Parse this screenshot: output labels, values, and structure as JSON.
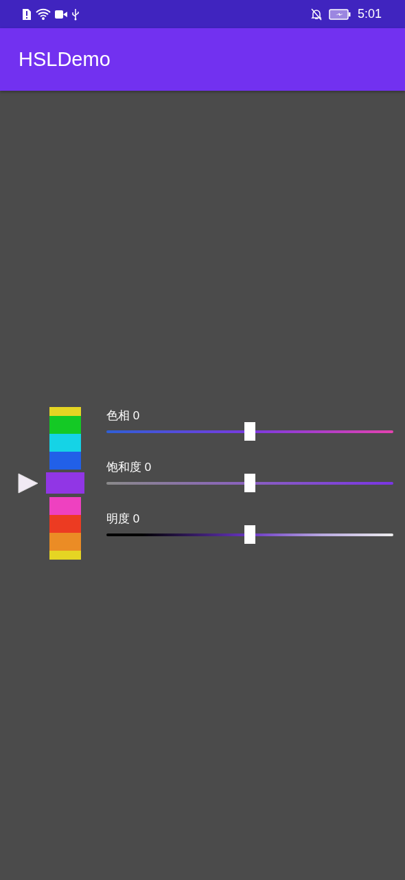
{
  "status_bar": {
    "time": "5:01"
  },
  "app_bar": {
    "title": "HSLDemo"
  },
  "swatches": [
    {
      "color": "#e5d523",
      "selected": false
    },
    {
      "color": "#14c925",
      "selected": false
    },
    {
      "color": "#15d3e6",
      "selected": false
    },
    {
      "color": "#2160e8",
      "selected": false
    },
    {
      "color": "#9136e5",
      "selected": true
    },
    {
      "color": "#ee41c0",
      "selected": false
    },
    {
      "color": "#ec3b22",
      "selected": false
    },
    {
      "color": "#eb8c25",
      "selected": false
    },
    {
      "color": "#e5d523",
      "selected": false
    }
  ],
  "sliders": [
    {
      "kind": "hue",
      "label": "色相 0",
      "level": 0.5
    },
    {
      "kind": "saturation",
      "label": "饱和度 0",
      "level": 0.5
    },
    {
      "kind": "lightness",
      "label": "明度 0",
      "level": 0.5
    }
  ]
}
